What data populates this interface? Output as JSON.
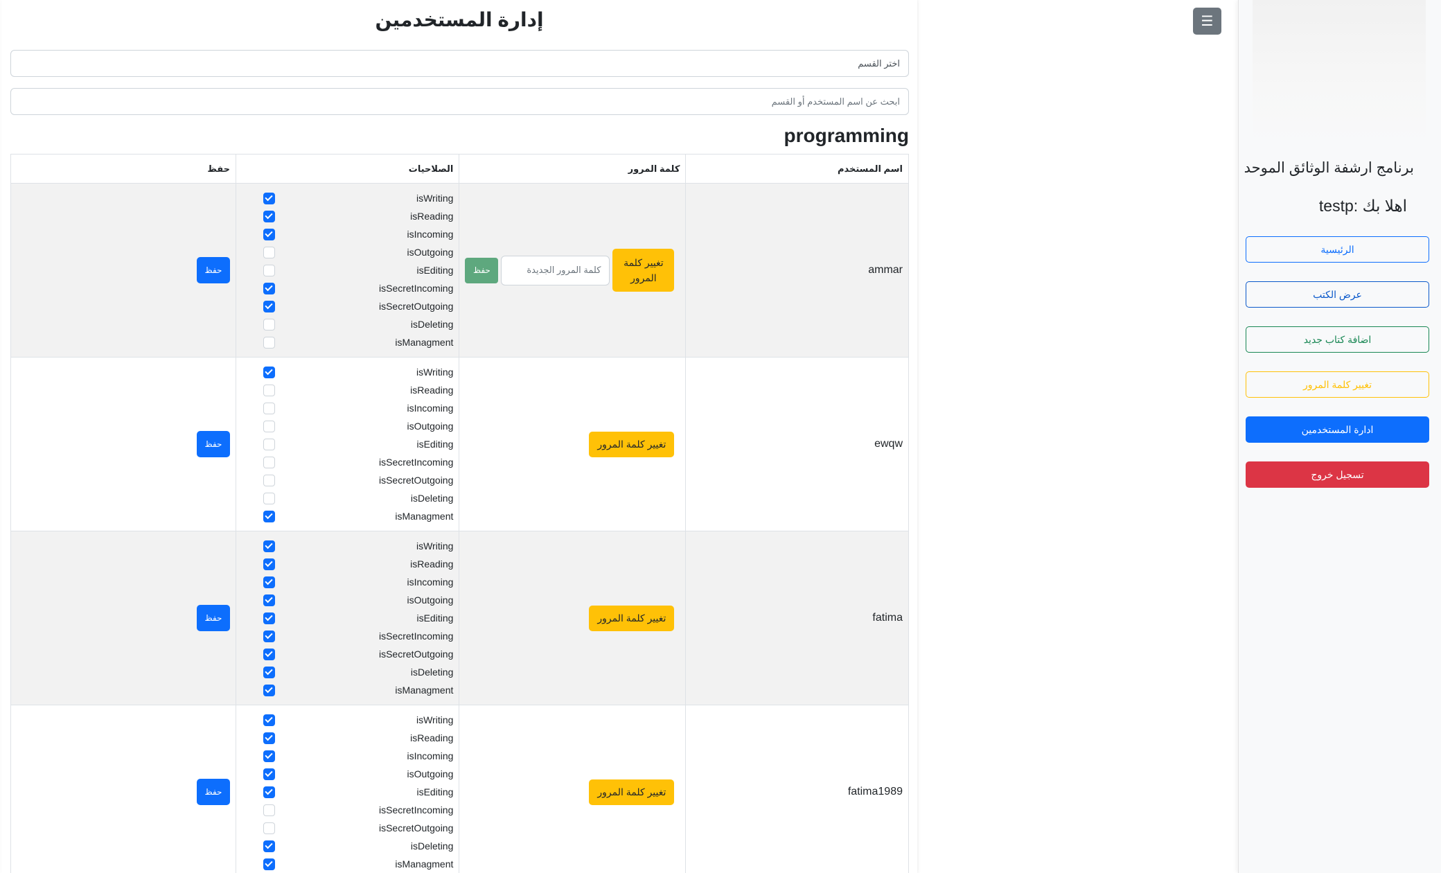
{
  "sidebar": {
    "title": "برنامج ارشفة الوثائق الموحد",
    "greeting": "اهلا بك :testp",
    "nav": {
      "home": "الرئيسية",
      "books": "عرض الكتب",
      "add_book": "اضافة كتاب جديد",
      "change_password": "تغيير كلمة المرور",
      "manage_users": "ادارة المستخدمين",
      "logout": "تسجيل خروج"
    }
  },
  "toggle_icon": "☰",
  "page": {
    "title": "إدارة المستخدمين",
    "dept_select_value": "اختر القسم",
    "search_placeholder": "ابحث عن اسم المستخدم أو القسم",
    "section_heading": "programming"
  },
  "table": {
    "headers": {
      "username": "اسم المستخدم",
      "password": "كلمة المرور",
      "permissions": "الصلاحيات",
      "save": "حفظ"
    },
    "change_password_label": "تغيير كلمة المرور",
    "new_password_placeholder": "كلمة المرور الجديدة",
    "password_save_label": "حفظ",
    "save_label": "حفظ",
    "permission_names": [
      "isWriting",
      "isReading",
      "isIncoming",
      "isOutgoing",
      "isEditing",
      "isSecretIncoming",
      "isSecretOutgoing",
      "isDeleting",
      "isManagment"
    ],
    "rows": [
      {
        "username": "ammar",
        "expanded": true,
        "perms": [
          true,
          true,
          true,
          false,
          false,
          true,
          true,
          false,
          false
        ]
      },
      {
        "username": "ewqw",
        "expanded": false,
        "perms": [
          true,
          false,
          false,
          false,
          false,
          false,
          false,
          false,
          true
        ]
      },
      {
        "username": "fatima",
        "expanded": false,
        "perms": [
          true,
          true,
          true,
          true,
          true,
          true,
          true,
          true,
          true
        ]
      },
      {
        "username": "fatima1989",
        "expanded": false,
        "perms": [
          true,
          true,
          true,
          true,
          true,
          false,
          false,
          true,
          true
        ]
      }
    ]
  },
  "colors": {
    "primary": "#0d6efd",
    "warning": "#ffc107",
    "danger": "#dc3545",
    "success": "#198754",
    "secondary": "#6c757d"
  }
}
